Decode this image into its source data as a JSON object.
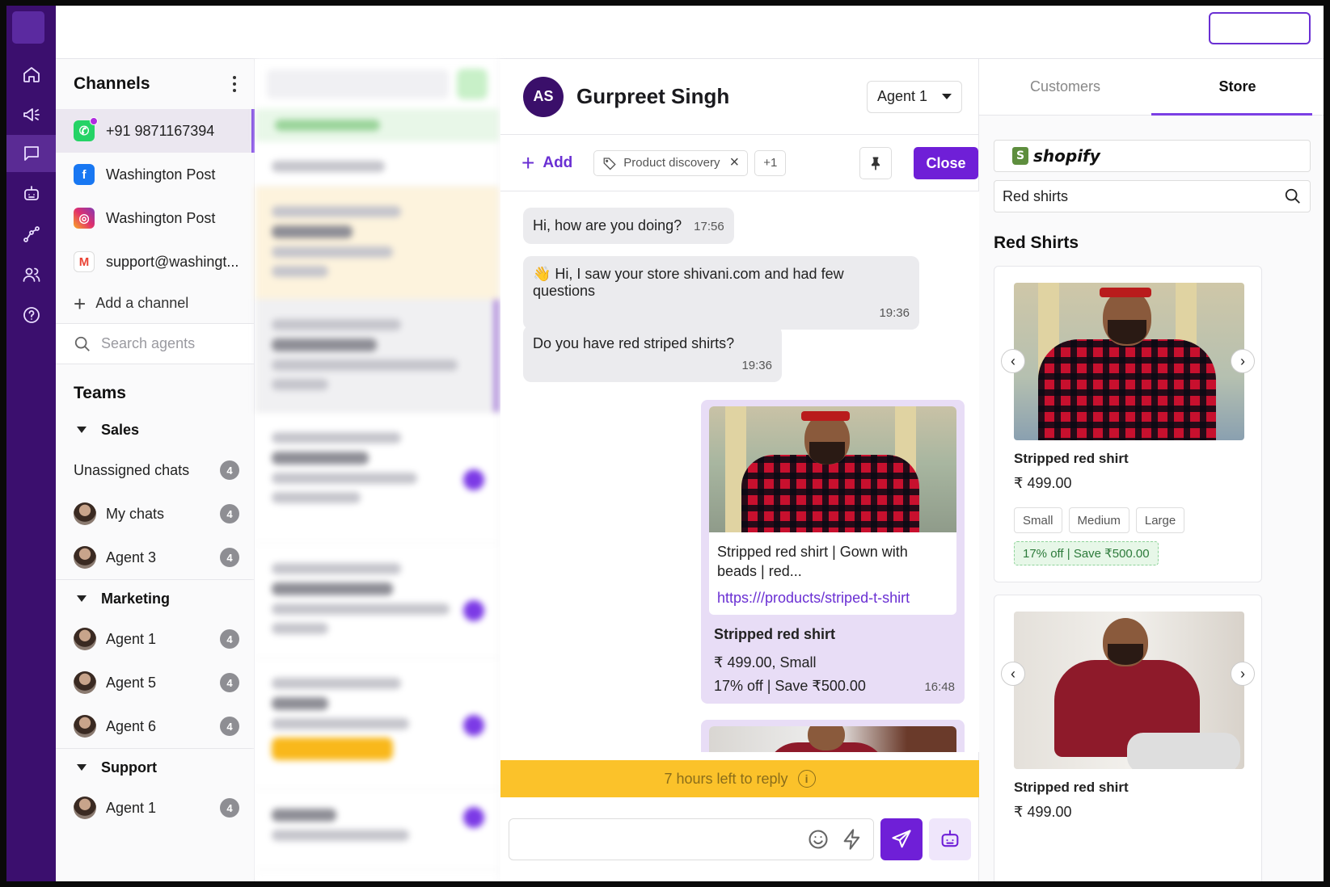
{
  "rail": {
    "items": [
      {
        "icon": "home-icon"
      },
      {
        "icon": "megaphone-icon"
      },
      {
        "icon": "chat-icon",
        "active": true
      },
      {
        "icon": "bot-icon"
      },
      {
        "icon": "flow-icon"
      },
      {
        "icon": "users-icon"
      },
      {
        "icon": "help-icon"
      }
    ]
  },
  "channels": {
    "title": "Channels",
    "items": [
      {
        "label": "+91 9871167394",
        "icon": "whatsapp-icon",
        "active": true
      },
      {
        "label": "Washington Post",
        "icon": "facebook-icon"
      },
      {
        "label": "Washington Post",
        "icon": "instagram-icon"
      },
      {
        "label": "support@washingt...",
        "icon": "gmail-icon"
      }
    ],
    "add_channel": "Add a channel",
    "search_placeholder": "Search agents"
  },
  "teams": {
    "title": "Teams",
    "groups": [
      {
        "name": "Sales",
        "rows": [
          {
            "label": "Unassigned chats",
            "count": "4",
            "avatar": false
          },
          {
            "label": "My chats",
            "count": "4",
            "avatar": true
          },
          {
            "label": "Agent 3",
            "count": "4",
            "avatar": true
          }
        ]
      },
      {
        "name": "Marketing",
        "rows": [
          {
            "label": "Agent 1",
            "count": "4",
            "avatar": true
          },
          {
            "label": "Agent 5",
            "count": "4",
            "avatar": true
          },
          {
            "label": "Agent 6",
            "count": "4",
            "avatar": true
          }
        ]
      },
      {
        "name": "Support",
        "rows": [
          {
            "label": "Agent 1",
            "count": "4",
            "avatar": true
          }
        ]
      }
    ]
  },
  "chat": {
    "avatar_initials": "AS",
    "customer_name": "Gurpreet Singh",
    "agent": "Agent 1",
    "add_label": "Add",
    "tag": "Product discovery",
    "more_tags": "+1",
    "close_label": "Close",
    "messages": [
      {
        "text": "Hi, how are you doing?",
        "time": "17:56"
      },
      {
        "text": "👋 Hi, I saw your store shivani.com and had few questions",
        "time": "19:36"
      },
      {
        "text": "Do you have red striped shirts?",
        "time": "19:36"
      }
    ],
    "outgoing": {
      "card_text": "Stripped red shirt | Gown with beads | red...",
      "link": "https:///products/striped-t-shirt",
      "title": "Stripped red shirt",
      "price_line": "₹ 499.00, Small",
      "offer_line": "17% off | Save ₹500.00",
      "time": "16:48"
    },
    "reply_notice": "7 hours left to reply",
    "info_glyph": "i"
  },
  "store": {
    "tabs": [
      {
        "label": "Customers"
      },
      {
        "label": "Store",
        "active": true
      }
    ],
    "platform": "shopify",
    "platform_glyph": "S",
    "search_value": "Red shirts",
    "heading": "Red Shirts",
    "products": [
      {
        "name": "Stripped red shirt",
        "price": "₹ 499.00",
        "sizes": [
          "Small",
          "Medium",
          "Large"
        ],
        "offer": "17% off | Save ₹500.00"
      },
      {
        "name": "Stripped red shirt",
        "price": "₹ 499.00"
      }
    ]
  }
}
